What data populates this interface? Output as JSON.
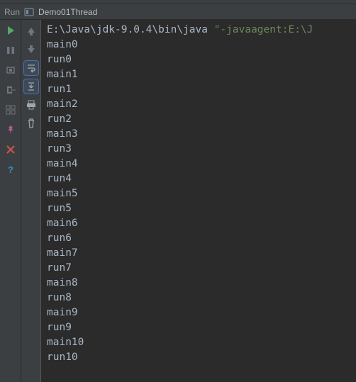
{
  "header": {
    "run_label": "Run",
    "config_name": "Demo01Thread"
  },
  "console": {
    "cmd_path": "E:\\Java\\jdk-9.0.4\\bin\\java ",
    "cmd_arg": "\"-javaagent:E:\\J",
    "lines": [
      "main0",
      "run0",
      "main1",
      "run1",
      "main2",
      "run2",
      "main3",
      "run3",
      "main4",
      "run4",
      "main5",
      "run5",
      "main6",
      "run6",
      "main7",
      "run7",
      "main8",
      "run8",
      "main9",
      "run9",
      "main10",
      "run10"
    ]
  },
  "left_icons": {
    "run": "run-icon",
    "pause": "pause-icon",
    "stop_frame": "frame-icon",
    "exit": "exit-icon",
    "layout": "layout-icon",
    "pin": "pin-icon",
    "close": "close-icon",
    "help": "help-icon"
  },
  "mid_icons": {
    "up": "arrow-up-icon",
    "down": "arrow-down-icon",
    "wrap": "wrap-icon",
    "scroll": "scroll-end-icon",
    "print": "print-icon",
    "trash": "trash-icon"
  }
}
